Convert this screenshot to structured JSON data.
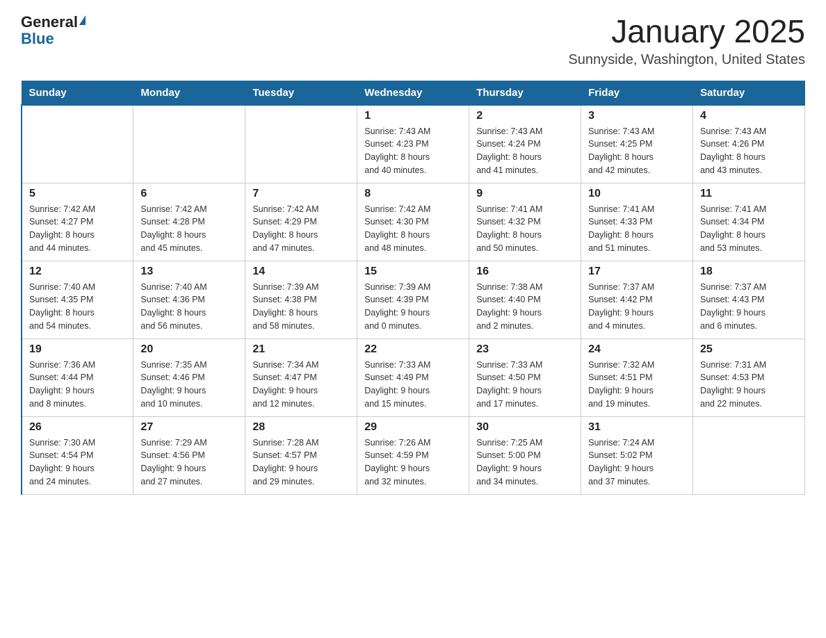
{
  "header": {
    "logo_general": "General",
    "logo_blue": "Blue",
    "title": "January 2025",
    "subtitle": "Sunnyside, Washington, United States"
  },
  "days_of_week": [
    "Sunday",
    "Monday",
    "Tuesday",
    "Wednesday",
    "Thursday",
    "Friday",
    "Saturday"
  ],
  "weeks": [
    [
      {
        "day": "",
        "info": ""
      },
      {
        "day": "",
        "info": ""
      },
      {
        "day": "",
        "info": ""
      },
      {
        "day": "1",
        "info": "Sunrise: 7:43 AM\nSunset: 4:23 PM\nDaylight: 8 hours\nand 40 minutes."
      },
      {
        "day": "2",
        "info": "Sunrise: 7:43 AM\nSunset: 4:24 PM\nDaylight: 8 hours\nand 41 minutes."
      },
      {
        "day": "3",
        "info": "Sunrise: 7:43 AM\nSunset: 4:25 PM\nDaylight: 8 hours\nand 42 minutes."
      },
      {
        "day": "4",
        "info": "Sunrise: 7:43 AM\nSunset: 4:26 PM\nDaylight: 8 hours\nand 43 minutes."
      }
    ],
    [
      {
        "day": "5",
        "info": "Sunrise: 7:42 AM\nSunset: 4:27 PM\nDaylight: 8 hours\nand 44 minutes."
      },
      {
        "day": "6",
        "info": "Sunrise: 7:42 AM\nSunset: 4:28 PM\nDaylight: 8 hours\nand 45 minutes."
      },
      {
        "day": "7",
        "info": "Sunrise: 7:42 AM\nSunset: 4:29 PM\nDaylight: 8 hours\nand 47 minutes."
      },
      {
        "day": "8",
        "info": "Sunrise: 7:42 AM\nSunset: 4:30 PM\nDaylight: 8 hours\nand 48 minutes."
      },
      {
        "day": "9",
        "info": "Sunrise: 7:41 AM\nSunset: 4:32 PM\nDaylight: 8 hours\nand 50 minutes."
      },
      {
        "day": "10",
        "info": "Sunrise: 7:41 AM\nSunset: 4:33 PM\nDaylight: 8 hours\nand 51 minutes."
      },
      {
        "day": "11",
        "info": "Sunrise: 7:41 AM\nSunset: 4:34 PM\nDaylight: 8 hours\nand 53 minutes."
      }
    ],
    [
      {
        "day": "12",
        "info": "Sunrise: 7:40 AM\nSunset: 4:35 PM\nDaylight: 8 hours\nand 54 minutes."
      },
      {
        "day": "13",
        "info": "Sunrise: 7:40 AM\nSunset: 4:36 PM\nDaylight: 8 hours\nand 56 minutes."
      },
      {
        "day": "14",
        "info": "Sunrise: 7:39 AM\nSunset: 4:38 PM\nDaylight: 8 hours\nand 58 minutes."
      },
      {
        "day": "15",
        "info": "Sunrise: 7:39 AM\nSunset: 4:39 PM\nDaylight: 9 hours\nand 0 minutes."
      },
      {
        "day": "16",
        "info": "Sunrise: 7:38 AM\nSunset: 4:40 PM\nDaylight: 9 hours\nand 2 minutes."
      },
      {
        "day": "17",
        "info": "Sunrise: 7:37 AM\nSunset: 4:42 PM\nDaylight: 9 hours\nand 4 minutes."
      },
      {
        "day": "18",
        "info": "Sunrise: 7:37 AM\nSunset: 4:43 PM\nDaylight: 9 hours\nand 6 minutes."
      }
    ],
    [
      {
        "day": "19",
        "info": "Sunrise: 7:36 AM\nSunset: 4:44 PM\nDaylight: 9 hours\nand 8 minutes."
      },
      {
        "day": "20",
        "info": "Sunrise: 7:35 AM\nSunset: 4:46 PM\nDaylight: 9 hours\nand 10 minutes."
      },
      {
        "day": "21",
        "info": "Sunrise: 7:34 AM\nSunset: 4:47 PM\nDaylight: 9 hours\nand 12 minutes."
      },
      {
        "day": "22",
        "info": "Sunrise: 7:33 AM\nSunset: 4:49 PM\nDaylight: 9 hours\nand 15 minutes."
      },
      {
        "day": "23",
        "info": "Sunrise: 7:33 AM\nSunset: 4:50 PM\nDaylight: 9 hours\nand 17 minutes."
      },
      {
        "day": "24",
        "info": "Sunrise: 7:32 AM\nSunset: 4:51 PM\nDaylight: 9 hours\nand 19 minutes."
      },
      {
        "day": "25",
        "info": "Sunrise: 7:31 AM\nSunset: 4:53 PM\nDaylight: 9 hours\nand 22 minutes."
      }
    ],
    [
      {
        "day": "26",
        "info": "Sunrise: 7:30 AM\nSunset: 4:54 PM\nDaylight: 9 hours\nand 24 minutes."
      },
      {
        "day": "27",
        "info": "Sunrise: 7:29 AM\nSunset: 4:56 PM\nDaylight: 9 hours\nand 27 minutes."
      },
      {
        "day": "28",
        "info": "Sunrise: 7:28 AM\nSunset: 4:57 PM\nDaylight: 9 hours\nand 29 minutes."
      },
      {
        "day": "29",
        "info": "Sunrise: 7:26 AM\nSunset: 4:59 PM\nDaylight: 9 hours\nand 32 minutes."
      },
      {
        "day": "30",
        "info": "Sunrise: 7:25 AM\nSunset: 5:00 PM\nDaylight: 9 hours\nand 34 minutes."
      },
      {
        "day": "31",
        "info": "Sunrise: 7:24 AM\nSunset: 5:02 PM\nDaylight: 9 hours\nand 37 minutes."
      },
      {
        "day": "",
        "info": ""
      }
    ]
  ]
}
